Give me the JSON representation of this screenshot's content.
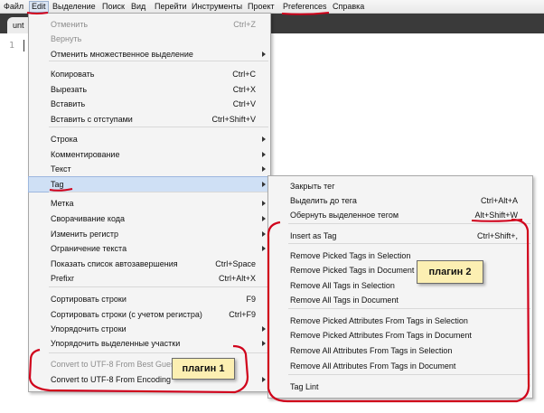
{
  "menubar": {
    "items": [
      "Файл",
      "Edit",
      "Выделение",
      "Поиск",
      "Вид",
      "Перейти",
      "Инструменты",
      "Проект",
      "Preferences",
      "Справка"
    ]
  },
  "editor": {
    "tab_label": "unt",
    "line_number": "1"
  },
  "edit_menu": {
    "items": [
      {
        "label": "Отменить",
        "shortcut": "Ctrl+Z",
        "disabled": true
      },
      {
        "label": "Вернуть",
        "disabled": true
      },
      {
        "label": "Отменить множественное выделение",
        "submenu": true
      },
      {
        "label": "Копировать",
        "shortcut": "Ctrl+C"
      },
      {
        "label": "Вырезать",
        "shortcut": "Ctrl+X"
      },
      {
        "label": "Вставить",
        "shortcut": "Ctrl+V"
      },
      {
        "label": "Вставить с отступами",
        "shortcut": "Ctrl+Shift+V"
      },
      {
        "label": "Строка",
        "submenu": true
      },
      {
        "label": "Комментирование",
        "submenu": true
      },
      {
        "label": "Текст",
        "submenu": true
      },
      {
        "label": "Tag",
        "submenu": true,
        "highlighted": true
      },
      {
        "label": "Метка",
        "submenu": true
      },
      {
        "label": "Сворачивание кода",
        "submenu": true
      },
      {
        "label": "Изменить регистр",
        "submenu": true
      },
      {
        "label": "Ограничение текста",
        "submenu": true
      },
      {
        "label": "Показать список автозавершения",
        "shortcut": "Ctrl+Space"
      },
      {
        "label": "Prefixr",
        "shortcut": "Ctrl+Alt+X"
      },
      {
        "label": "Сортировать строки",
        "shortcut": "F9"
      },
      {
        "label": "Сортировать строки (с учетом регистра)",
        "shortcut": "Ctrl+F9"
      },
      {
        "label": "Упорядочить строки",
        "submenu": true
      },
      {
        "label": "Упорядочить выделенные участки",
        "submenu": true
      },
      {
        "label": "Convert to UTF-8 From Best Guess",
        "disabled": true
      },
      {
        "label": "Convert to UTF-8 From Encoding",
        "submenu": true
      }
    ]
  },
  "tag_menu": {
    "items": [
      {
        "label": "Закрыть тег"
      },
      {
        "label": "Выделить до тега",
        "shortcut": "Ctrl+Alt+A"
      },
      {
        "label": "Обернуть выделенное тегом",
        "shortcut": "Alt+Shift+W"
      },
      {
        "label": "Insert as Tag",
        "shortcut": "Ctrl+Shift+,"
      },
      {
        "label": "Remove Picked Tags in Selection"
      },
      {
        "label": "Remove Picked Tags in Document"
      },
      {
        "label": "Remove All Tags in Selection"
      },
      {
        "label": "Remove All Tags in Document"
      },
      {
        "label": "Remove Picked Attributes From Tags in Selection"
      },
      {
        "label": "Remove Picked Attributes From Tags in Document"
      },
      {
        "label": "Remove All Attributes From Tags in Selection"
      },
      {
        "label": "Remove All Attributes From Tags in Document"
      },
      {
        "label": "Tag Lint"
      }
    ]
  },
  "annotations": {
    "plugin1_label": "плагин 1",
    "plugin2_label": "плагин 2",
    "color": "#d0021b",
    "note_bg": "#fcefb2"
  }
}
